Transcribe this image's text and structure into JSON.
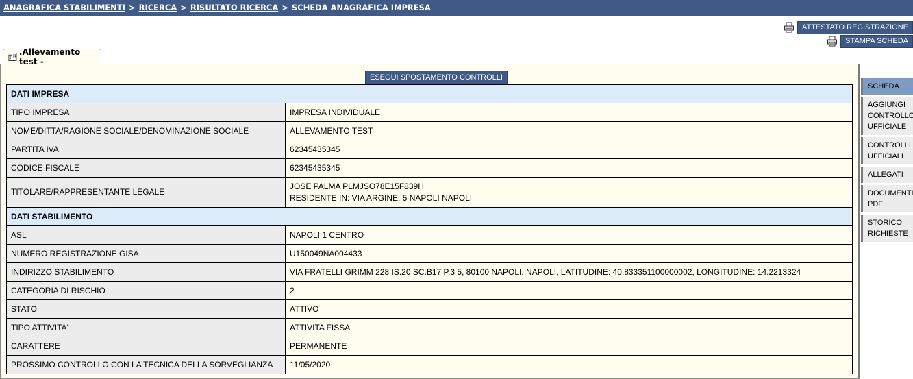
{
  "breadcrumb": {
    "item1": "ANAGRAFICA STABILIMENTI",
    "item2": "RICERCA",
    "item3": "RISULTATO RICERCA",
    "current": "SCHEDA ANAGRAFICA IMPRESA",
    "separator": ">"
  },
  "actions": {
    "attestato": "ATTESTATO REGISTRAZIONE",
    "stampa": "STAMPA SCHEDA"
  },
  "tab": {
    "label": ".Allevamento test -"
  },
  "exec_button": "ESEGUI SPOSTAMENTO CONTROLLI",
  "sections": {
    "impresa": "DATI IMPRESA",
    "stabilimento": "DATI STABILIMENTO"
  },
  "impresa_rows": [
    {
      "label": "TIPO IMPRESA",
      "value": "IMPRESA INDIVIDUALE"
    },
    {
      "label": "NOME/DITTA/RAGIONE SOCIALE/DENOMINAZIONE SOCIALE",
      "value": "ALLEVAMENTO TEST"
    },
    {
      "label": "PARTITA IVA",
      "value": "62345435345"
    },
    {
      "label": "CODICE FISCALE",
      "value": "62345435345"
    },
    {
      "label": "TITOLARE/RAPPRESENTANTE LEGALE",
      "value": "JOSE PALMA PLMJSO78E15F839H",
      "value2": "RESIDENTE IN: VIA ARGINE, 5 NAPOLI NAPOLI"
    }
  ],
  "stabilimento_rows": [
    {
      "label": "ASL",
      "value": "NAPOLI 1 CENTRO"
    },
    {
      "label": "NUMERO REGISTRAZIONE GISA",
      "value": "U150049NA004433"
    },
    {
      "label": "INDIRIZZO STABILIMENTO",
      "value": "VIA FRATELLI GRIMM 228 IS.20 SC.B17 P.3 5, 80100 NAPOLI, NAPOLI, LATITUDINE: 40.833351100000002, LONGITUDINE: 14.2213324"
    },
    {
      "label": "CATEGORIA DI RISCHIO",
      "value": "2"
    },
    {
      "label": "STATO",
      "value": "ATTIVO"
    },
    {
      "label": "TIPO ATTIVITA'",
      "value": "ATTIVITA FISSA"
    },
    {
      "label": "CARATTERE",
      "value": "PERMANENTE"
    },
    {
      "label": "PROSSIMO CONTROLLO CON LA TECNICA DELLA SORVEGLIANZA",
      "value": "11/05/2020"
    }
  ],
  "sidebar": {
    "items": [
      {
        "line1": "SCHEDA"
      },
      {
        "line1": "AGGIUNGI",
        "line2": "CONTROLLO",
        "line3": "UFFICIALE"
      },
      {
        "line1": "CONTROLLI",
        "line2": "UFFICIALI"
      },
      {
        "line1": "ALLEGATI"
      },
      {
        "line1": "DOCUMENTI",
        "line2": "PDF"
      },
      {
        "line1": "STORICO",
        "line2": "RICHIESTE"
      }
    ]
  },
  "colors": {
    "header_blue": "#3f5a86",
    "section_blue": "#dcebfa",
    "panel_cream": "#fffdf0",
    "active_tab": "#7f9cc4"
  }
}
